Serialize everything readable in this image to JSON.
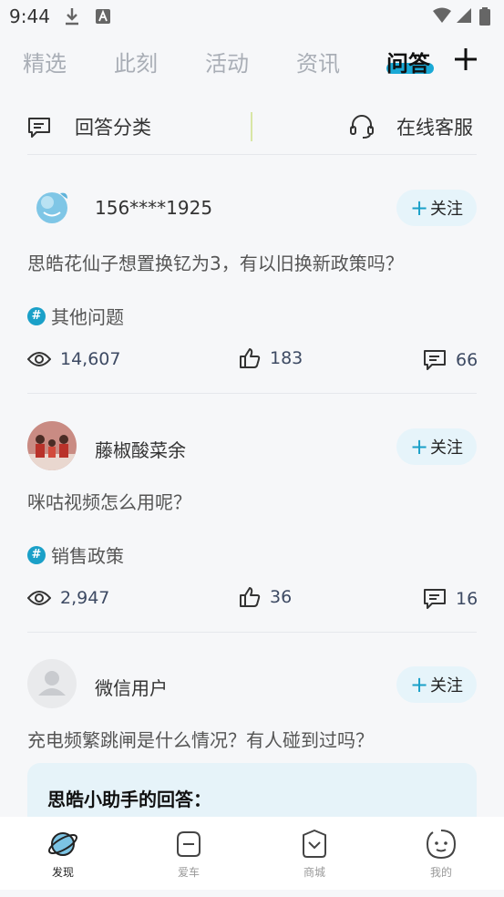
{
  "status": {
    "time": "9:44",
    "icons": [
      "download-icon",
      "a-square-icon",
      "wifi-icon",
      "signal-icon",
      "battery-icon"
    ]
  },
  "tabs": [
    {
      "label": "精选",
      "active": false
    },
    {
      "label": "此刻",
      "active": false
    },
    {
      "label": "活动",
      "active": false
    },
    {
      "label": "资讯",
      "active": false
    },
    {
      "label": "问答",
      "active": true
    }
  ],
  "toolbar": {
    "category_label": "回答分类",
    "service_label": "在线客服"
  },
  "posts": [
    {
      "user": "156****1925",
      "follow_label": "关注",
      "question": "思皓花仙子想置换钇为3，有以旧换新政策吗？",
      "topic": "其他问题",
      "views": "14,607",
      "likes": "183",
      "comments": "66"
    },
    {
      "user": "藤椒酸菜余",
      "follow_label": "关注",
      "question": "咪咕视频怎么用呢？",
      "topic": "销售政策",
      "views": "2,947",
      "likes": "36",
      "comments": "16"
    },
    {
      "user": "微信用户",
      "follow_label": "关注",
      "question": "充电频繁跳闸是什么情况？有人碰到过吗？",
      "answer_title": "思皓小助手的回答："
    }
  ],
  "nav": [
    {
      "label": "发现",
      "icon": "planet-icon",
      "active": true
    },
    {
      "label": "爱车",
      "icon": "car-icon",
      "active": false
    },
    {
      "label": "商城",
      "icon": "shop-icon",
      "active": false
    },
    {
      "label": "我的",
      "icon": "face-icon",
      "active": false
    }
  ],
  "colors": {
    "accent": "#1aa9d6",
    "background": "#f6f7f9",
    "follow_bg": "#e6f4fa"
  }
}
